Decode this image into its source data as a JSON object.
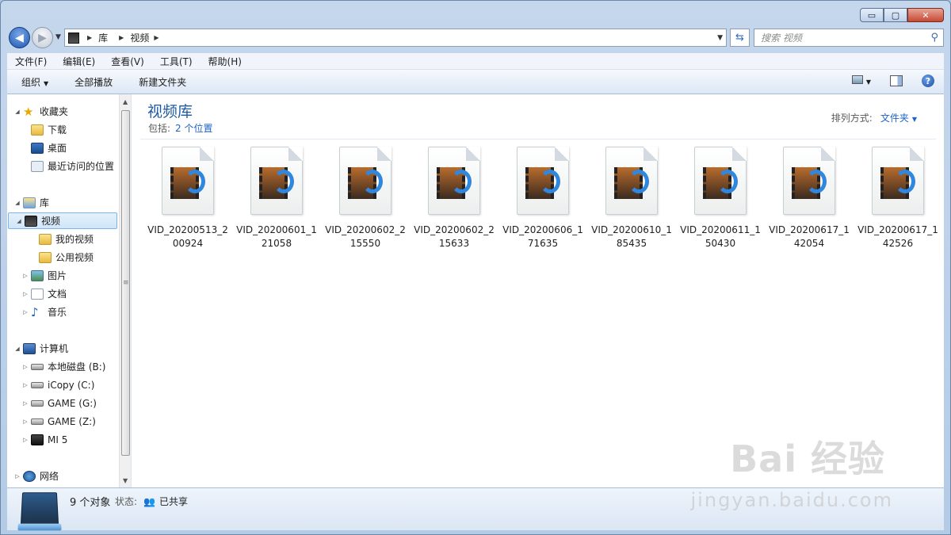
{
  "window": {
    "min": "▭",
    "max": "▢",
    "close": "✕"
  },
  "address": {
    "root_icon": "video-library-icon",
    "path": [
      "库",
      "视频"
    ]
  },
  "search": {
    "placeholder": "搜索 视频"
  },
  "menu": [
    "文件(F)",
    "编辑(E)",
    "查看(V)",
    "工具(T)",
    "帮助(H)"
  ],
  "toolbar": {
    "organize": "组织",
    "play_all": "全部播放",
    "new_folder": "新建文件夹"
  },
  "nav": {
    "favorites": "收藏夹",
    "downloads": "下载",
    "desktop": "桌面",
    "recent": "最近访问的位置",
    "libraries": "库",
    "videos": "视频",
    "my_videos": "我的视频",
    "public_videos": "公用视频",
    "pictures": "图片",
    "documents": "文档",
    "music": "音乐",
    "computer": "计算机",
    "drive_b": "本地磁盘 (B:)",
    "drive_c": "iCopy (C:)",
    "drive_g": "GAME (G:)",
    "drive_z": "GAME (Z:)",
    "phone": "MI 5",
    "network": "网络"
  },
  "library": {
    "title": "视频库",
    "includes_label": "包括:",
    "locations": "2 个位置",
    "sort_label": "排列方式:",
    "sort_value": "文件夹"
  },
  "files": [
    {
      "name": "VID_20200513_200924"
    },
    {
      "name": "VID_20200601_121058"
    },
    {
      "name": "VID_20200602_215550"
    },
    {
      "name": "VID_20200602_215633"
    },
    {
      "name": "VID_20200606_171635"
    },
    {
      "name": "VID_20200610_185435"
    },
    {
      "name": "VID_20200611_150430"
    },
    {
      "name": "VID_20200617_142054"
    },
    {
      "name": "VID_20200617_142526"
    }
  ],
  "status": {
    "count": "9 个对象",
    "state_label": "状态:",
    "state_value": "已共享"
  },
  "watermark": {
    "brand": "Bai 经验",
    "url": "jingyan.baidu.com"
  }
}
